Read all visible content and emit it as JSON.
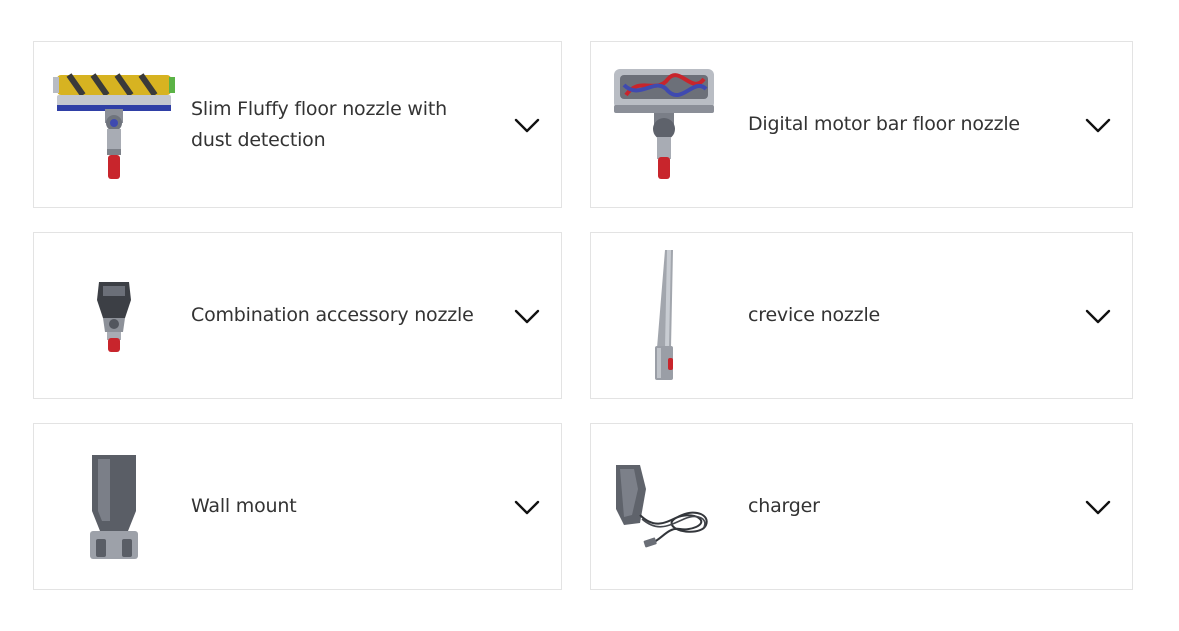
{
  "accessories": [
    {
      "label": "Slim Fluffy floor nozzle with dust detection",
      "image_icon": "slim-fluffy-nozzle-icon"
    },
    {
      "label": "Digital motor bar floor nozzle",
      "image_icon": "motorbar-nozzle-icon"
    },
    {
      "label": "Combination accessory nozzle",
      "image_icon": "combination-nozzle-icon"
    },
    {
      "label": "crevice nozzle",
      "image_icon": "crevice-nozzle-icon"
    },
    {
      "label": "Wall mount",
      "image_icon": "wall-mount-icon"
    },
    {
      "label": "charger",
      "image_icon": "charger-icon"
    }
  ],
  "expand_icon": "chevron-down-icon",
  "colors": {
    "card_border": "#e3e3e3",
    "text": "#333333",
    "accent_red": "#c8252c",
    "accent_yellow": "#f2c12e",
    "accent_blue": "#2f3fa6",
    "metal": "#9a9ea6"
  }
}
